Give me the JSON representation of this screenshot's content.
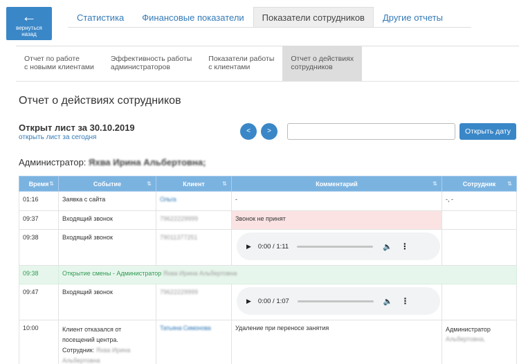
{
  "back_button": {
    "icon": "arrow-left-icon",
    "label_line1": "вернуться",
    "label_line2": "назад"
  },
  "top_tabs": [
    {
      "label": "Статистика",
      "active": false
    },
    {
      "label": "Финансовые показатели",
      "active": false
    },
    {
      "label": "Показатели сотрудников",
      "active": true
    },
    {
      "label": "Другие отчеты",
      "active": false
    }
  ],
  "sub_tabs": [
    {
      "label": "Отчет по работе\nс новыми клиентами",
      "active": false
    },
    {
      "label": "Эффективность работы\nадминистраторов",
      "active": false
    },
    {
      "label": "Показатели работы\nс клиентами",
      "active": false
    },
    {
      "label": "Отчет о действиях\nсотрудников",
      "active": true
    }
  ],
  "page_title": "Отчет о действиях сотрудников",
  "sheet": {
    "title": "Открыт лист за 30.10.2019",
    "today_link": "открыть лист за сегодня"
  },
  "nav": {
    "prev": "<",
    "next": ">",
    "open_date": "Открыть дату",
    "date_value": ""
  },
  "admin": {
    "label": "Администратор:",
    "name": "Яхва Ирина Альбертовна;"
  },
  "table": {
    "headers": [
      "Время",
      "Событие",
      "Клиент",
      "Комментарий",
      "Сотрудник"
    ],
    "rows": [
      {
        "time": "01:16",
        "event": "Заявка с сайта",
        "client": "Ольга",
        "comment": "-",
        "employee": "-, -"
      },
      {
        "time": "09:37",
        "event": "Входящий звонок",
        "client": "79622229999",
        "comment": "Звонок не принят",
        "employee": ""
      },
      {
        "time": "09:38",
        "event": "Входящий звонок",
        "client": "79011377251",
        "player_time": "0:00 / 1:11",
        "player_progress": 0.0,
        "employee": ""
      },
      {
        "time": "09:38",
        "event": "Открытие смены - Администратор",
        "event_name": "Яхва Ирина Альбертовна"
      },
      {
        "time": "09:47",
        "event": "Входящий звонок",
        "client": "79622229999",
        "player_time": "0:00 / 1:07",
        "player_progress": 0.0,
        "employee": ""
      },
      {
        "time": "10:00",
        "event_line1": "Клиент отказался от",
        "event_line2": "посещений центра.",
        "event_line3": "Сотрудник:",
        "event_blur": "Яхва Ирина",
        "event_blur2": "Альбертовна",
        "client": "Татьяна Симонова",
        "comment": "Удаление при переносе занятия",
        "employee_line1": "Администратор",
        "employee_line2": "Альбертовна,"
      }
    ]
  }
}
